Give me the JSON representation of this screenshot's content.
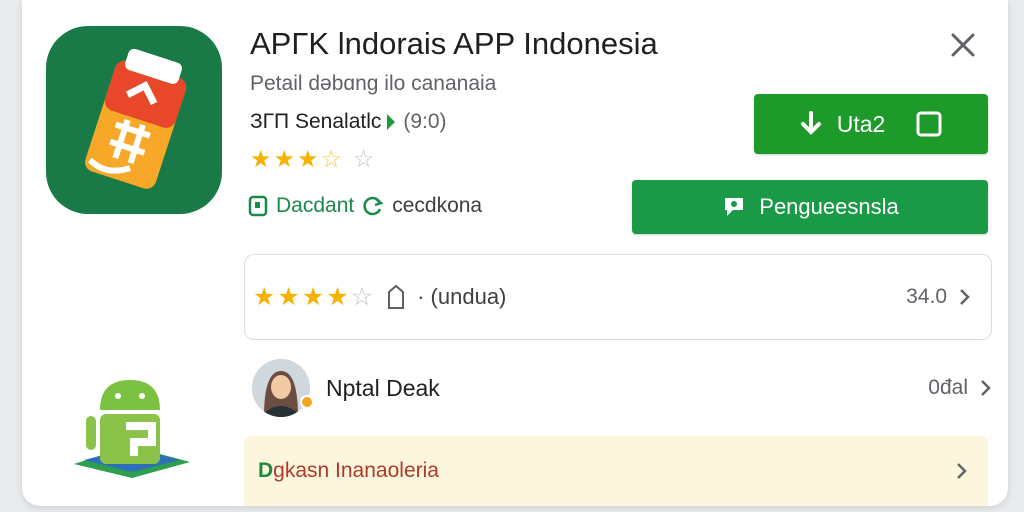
{
  "app": {
    "title": "APΓK lndorais APP Indonesia",
    "subtitle": "Petail dǝbɑng ilo cananaia",
    "developer": "ЗГП Senalatlc",
    "rating_count": "(9:0)",
    "icon_name": "app-logo-icon"
  },
  "tags": {
    "tag_a": "Dacdant",
    "tag_b": "cecdkona"
  },
  "buttons": {
    "primary_label": "Uta2",
    "secondary_label": "Pengueesnsla"
  },
  "rating_row": {
    "meta": "· (undua)",
    "value": "34.0"
  },
  "user_row": {
    "name": "Nptal Deak",
    "value": "0đal"
  },
  "promo": {
    "prefix": "D",
    "text": "gkasn Inanaoleria"
  },
  "colors": {
    "accent_green": "#1e9a2a",
    "secondary_green": "#1a9946",
    "icon_bg": "#1a7a47",
    "star": "#f5b301",
    "promo_bg": "#fbf6dc"
  }
}
